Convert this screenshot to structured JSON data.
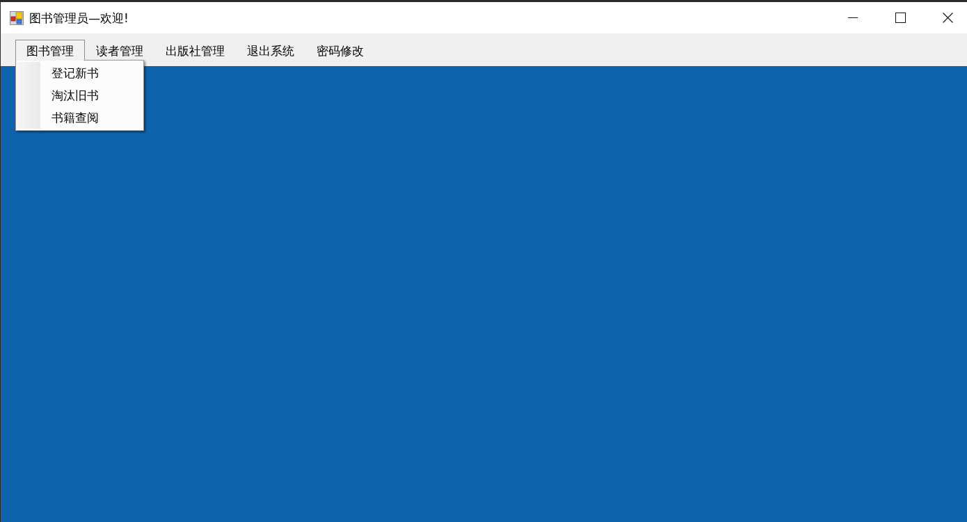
{
  "window": {
    "title": "图书管理员—欢迎!"
  },
  "menu_bar": {
    "items": [
      {
        "label": "图书管理",
        "selected": true,
        "submenu": [
          {
            "label": "登记新书"
          },
          {
            "label": "淘汰旧书"
          },
          {
            "label": "书籍查阅"
          }
        ]
      },
      {
        "label": "读者管理",
        "selected": false
      },
      {
        "label": "出版社管理",
        "selected": false
      },
      {
        "label": "退出系统",
        "selected": false
      },
      {
        "label": "密码修改",
        "selected": false
      }
    ]
  }
}
